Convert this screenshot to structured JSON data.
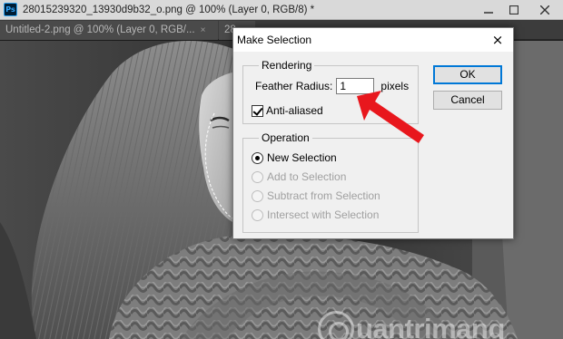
{
  "window": {
    "app_icon": "photoshop-icon",
    "title": "28015239320_13930d9b32_o.png @ 100% (Layer 0, RGB/8) *",
    "minimize_icon": "minimize-icon",
    "maximize_icon": "maximize-icon",
    "close_icon": "close-icon"
  },
  "tabs": [
    {
      "label": "Untitled-2.png @ 100% (Layer 0, RGB/...",
      "close_glyph": "×"
    },
    {
      "label": "28"
    }
  ],
  "watermark": {
    "text": "uantrimang"
  },
  "dialog": {
    "title": "Make Selection",
    "close_glyph": "×",
    "rendering": {
      "legend": "Rendering",
      "feather_label": "Feather Radius:",
      "feather_value": "1",
      "feather_unit": "pixels",
      "anti_aliased_label": "Anti-aliased",
      "anti_aliased_checked": true
    },
    "operation": {
      "legend": "Operation",
      "options": [
        {
          "label": "New Selection",
          "selected": true,
          "enabled": true
        },
        {
          "label": "Add to Selection",
          "selected": false,
          "enabled": false
        },
        {
          "label": "Subtract from Selection",
          "selected": false,
          "enabled": false
        },
        {
          "label": "Intersect with Selection",
          "selected": false,
          "enabled": false
        }
      ]
    },
    "ok_label": "OK",
    "cancel_label": "Cancel"
  },
  "colors": {
    "annotation_arrow": "#e8171d",
    "accent": "#0078d7"
  }
}
